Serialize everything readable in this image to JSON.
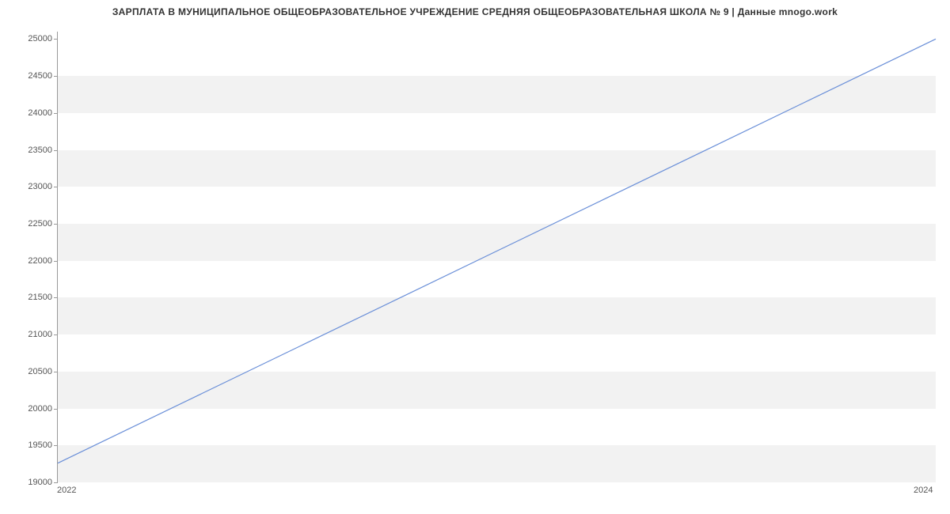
{
  "chart_data": {
    "type": "line",
    "title": "ЗАРПЛАТА В МУНИЦИПАЛЬНОЕ ОБЩЕОБРАЗОВАТЕЛЬНОЕ УЧРЕЖДЕНИЕ СРЕДНЯЯ ОБЩЕОБРАЗОВАТЕЛЬНАЯ ШКОЛА № 9 | Данные mnogo.work",
    "xlabel": "",
    "ylabel": "",
    "x": [
      2022,
      2024
    ],
    "values": [
      19250,
      25000
    ],
    "x_ticks": [
      2022,
      2024
    ],
    "y_ticks": [
      19000,
      19500,
      20000,
      20500,
      21000,
      21500,
      22000,
      22500,
      23000,
      23500,
      24000,
      24500,
      25000
    ],
    "xlim": [
      2022,
      2024
    ],
    "ylim": [
      19000,
      25100
    ]
  },
  "colors": {
    "line": "#6a8fd8",
    "band": "#f2f2f2",
    "axis": "#999999"
  }
}
